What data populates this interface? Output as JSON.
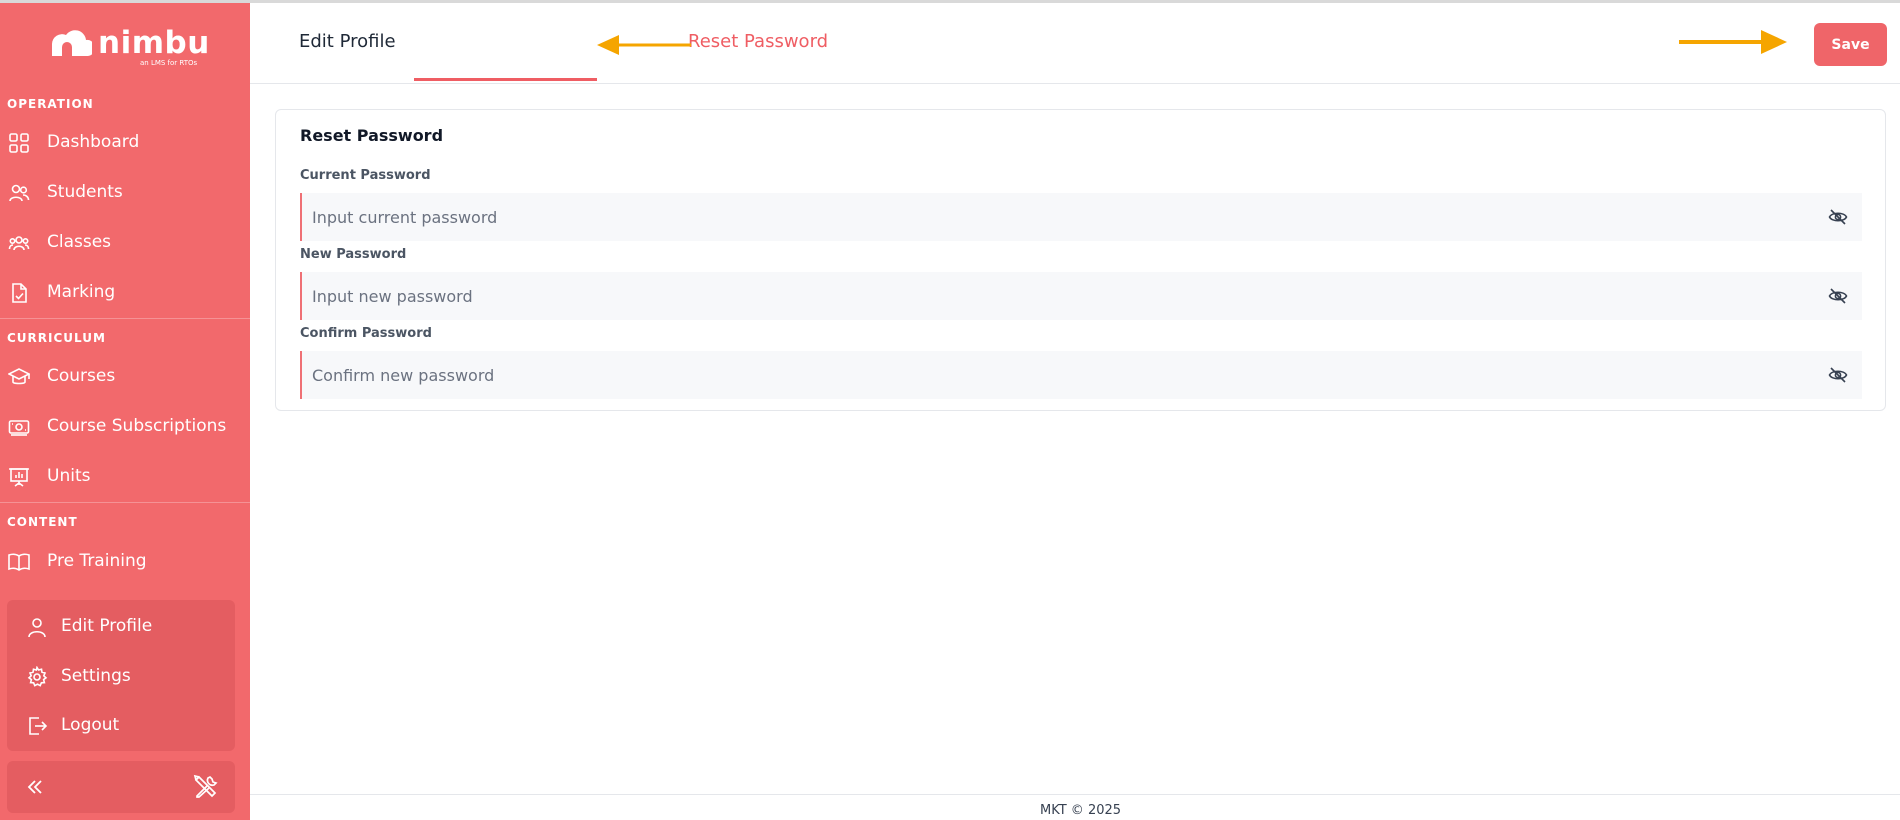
{
  "brand": {
    "name": "nimbu",
    "tagline": "an LMS for RTOs",
    "sidebar_color": "#f2696c",
    "accent": "#ef5d63"
  },
  "sidebar": {
    "sections": [
      {
        "label": "OPERATION",
        "items": [
          {
            "label": "Dashboard",
            "icon": "grid-icon"
          },
          {
            "label": "Students",
            "icon": "users-icon"
          },
          {
            "label": "Classes",
            "icon": "group-icon"
          },
          {
            "label": "Marking",
            "icon": "file-check-icon"
          }
        ]
      },
      {
        "label": "CURRICULUM",
        "items": [
          {
            "label": "Courses",
            "icon": "graduation-cap-icon"
          },
          {
            "label": "Course Subscriptions",
            "icon": "money-icon"
          },
          {
            "label": "Units",
            "icon": "presentation-icon"
          }
        ]
      },
      {
        "label": "CONTENT",
        "items": [
          {
            "label": "Pre Training",
            "icon": "book-open-icon"
          }
        ]
      }
    ],
    "profile_menu": [
      {
        "label": "Edit Profile",
        "icon": "user-icon"
      },
      {
        "label": "Settings",
        "icon": "gear-icon"
      },
      {
        "label": "Logout",
        "icon": "logout-icon"
      }
    ],
    "bottom": {
      "collapse_icon": "chevrons-left-icon",
      "tools_icon": "tools-icon"
    }
  },
  "tabs": [
    {
      "label": "Edit Profile",
      "active": false
    },
    {
      "label": "Reset Password",
      "active": true
    }
  ],
  "toolbar": {
    "save_label": "Save"
  },
  "form": {
    "title": "Reset Password",
    "fields": [
      {
        "label": "Current Password",
        "placeholder": "Input current password",
        "icon": "eye-off-icon"
      },
      {
        "label": "New Password",
        "placeholder": "Input new password",
        "icon": "eye-off-icon"
      },
      {
        "label": "Confirm Password",
        "placeholder": "Confirm new password",
        "icon": "eye-off-icon"
      }
    ]
  },
  "annotations": {
    "arrow_color": "#f5a500"
  },
  "footer": {
    "text": "MKT © 2025"
  }
}
